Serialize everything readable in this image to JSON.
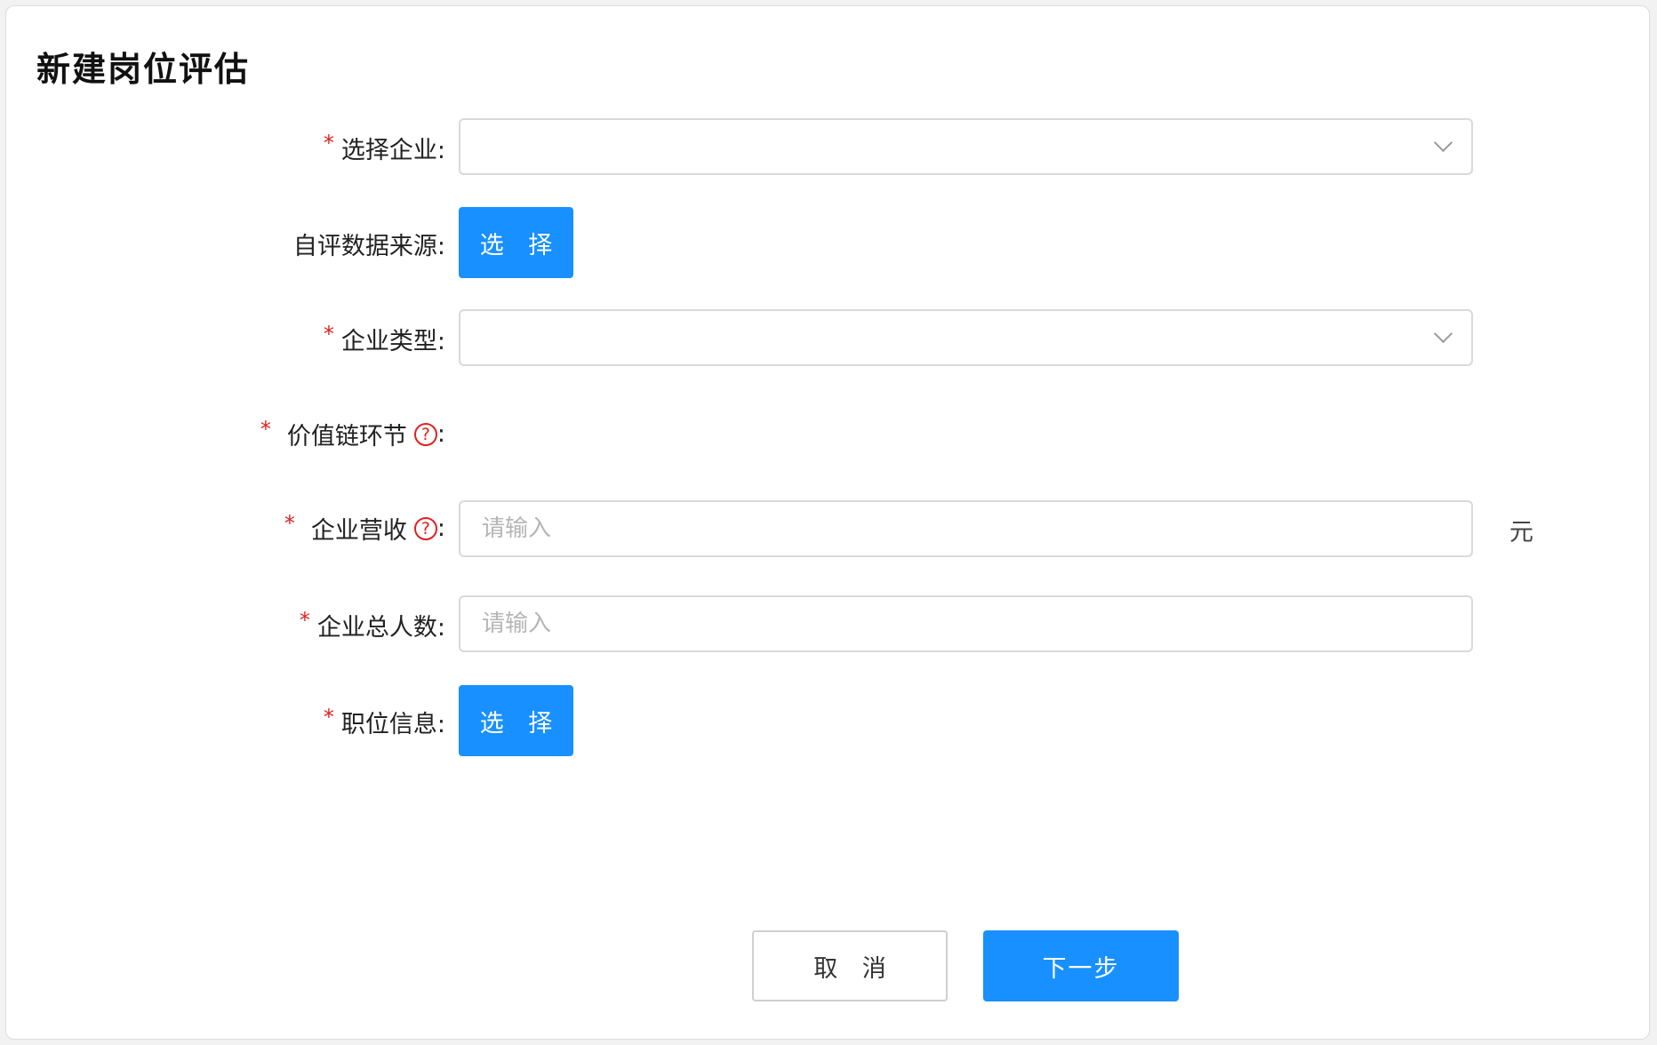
{
  "title": "新建岗位评估",
  "form": {
    "company": {
      "label": "选择企业:",
      "required": true
    },
    "self_eval_source": {
      "label": "自评数据来源:",
      "required": false,
      "button_label": "选 择"
    },
    "company_type": {
      "label": "企业类型:",
      "required": true
    },
    "value_chain": {
      "label": "价值链环节",
      "required": true,
      "help": "?",
      "colon": ":"
    },
    "revenue": {
      "label": "企业营收",
      "required": true,
      "help": "?",
      "colon": ":",
      "placeholder": "请输入",
      "unit": "元"
    },
    "headcount": {
      "label": "企业总人数:",
      "required": true,
      "placeholder": "请输入"
    },
    "position_info": {
      "label": "职位信息:",
      "required": true,
      "button_label": "选 择"
    }
  },
  "actions": {
    "cancel_label": "取 消",
    "next_label": "下一步"
  },
  "colors": {
    "primary": "#1890ff",
    "required": "#e02020",
    "border": "#d9d9d9"
  },
  "icons": {
    "select_arrow": "chevron-down-icon",
    "help": "question-circle-icon"
  }
}
